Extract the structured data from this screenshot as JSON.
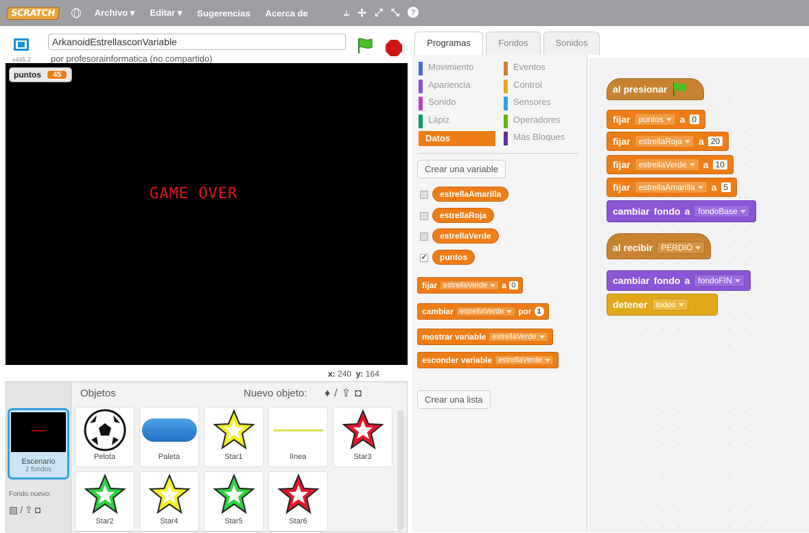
{
  "topbar": {
    "logo": "SCRATCH",
    "menus": [
      "Archivo ▾",
      "Editar ▾",
      "Sugerencias",
      "Acerca de"
    ],
    "tools": [
      "⥿",
      "✢",
      "⤢",
      "⤡",
      "?"
    ],
    "tool_icons": [
      "duplicate-stamp-icon",
      "delete-scissors-icon",
      "grow-icon",
      "shrink-icon",
      "help-icon"
    ]
  },
  "stage": {
    "version": "v445.2",
    "project_title": "ArkanoidEstrellasconVariable",
    "author": "por profesorainformatica (no compartido)",
    "monitor_label": "puntos",
    "monitor_value": "45",
    "game_over_text": "GAME OVER",
    "coords_x_label": "x:",
    "coords_x": "240",
    "coords_y_label": "y:",
    "coords_y": "164"
  },
  "sprites_pane": {
    "header": "Objetos",
    "new_object_label": "Nuevo objeto:",
    "stage_name": "Escenario",
    "stage_backdrops": "2 fondos",
    "new_backdrop_label": "Fondo nuevo:",
    "sprites": [
      "Pelota",
      "Paleta",
      "Star1",
      "línea",
      "Star3",
      "Star2",
      "Star4",
      "Star5",
      "Star6"
    ]
  },
  "tabs": [
    "Programas",
    "Fondos",
    "Sonidos"
  ],
  "categories": [
    {
      "label": "Movimiento",
      "color": "#4a6cd4"
    },
    {
      "label": "Eventos",
      "color": "#c88330"
    },
    {
      "label": "Apariencia",
      "color": "#8a55d7"
    },
    {
      "label": "Control",
      "color": "#e1a91a"
    },
    {
      "label": "Sonido",
      "color": "#bb42c3"
    },
    {
      "label": "Sensores",
      "color": "#2ca5e2"
    },
    {
      "label": "Lápiz",
      "color": "#0e9a6c"
    },
    {
      "label": "Operadores",
      "color": "#5cb712"
    },
    {
      "label": "Datos",
      "color": "#ee7d16"
    },
    {
      "label": "Más Bloques",
      "color": "#632d99"
    }
  ],
  "palette": {
    "make_variable": "Crear una variable",
    "variables": [
      "estrellaAmarilla",
      "estrellaRoja",
      "estrellaVerde",
      "puntos"
    ],
    "checked": "✓",
    "set_block": {
      "kw": "fijar",
      "var": "estrellaVerde",
      "to": "a",
      "val": "0"
    },
    "change_block": {
      "kw": "cambiar",
      "var": "estrellaVerde",
      "by": "por",
      "val": "1"
    },
    "show_block": {
      "kw": "mostrar variable",
      "var": "estrellaVerde"
    },
    "hide_block": {
      "kw": "esconder variable",
      "var": "estrellaVerde"
    },
    "make_list": "Crear una lista"
  },
  "script1": {
    "hat": "al presionar",
    "blocks": [
      {
        "kw": "fijar",
        "var": "puntos",
        "to": "a",
        "val": "0"
      },
      {
        "kw": "fijar",
        "var": "estrellaRoja",
        "to": "a",
        "val": "20"
      },
      {
        "kw": "fijar",
        "var": "estrellaVerde",
        "to": "a",
        "val": "10"
      },
      {
        "kw": "fijar",
        "var": "estrellaAmarilla",
        "to": "a",
        "val": "5"
      }
    ],
    "switch": {
      "kw1": "cambiar",
      "kw2": "fondo",
      "kw3": "a",
      "val": "fondoBase"
    }
  },
  "script2": {
    "hat": "al recibir",
    "msg": "PERDIÓ",
    "switch": {
      "kw1": "cambiar",
      "kw2": "fondo",
      "kw3": "a",
      "val": "fondoFIN"
    },
    "stop": {
      "kw": "detener",
      "val": "todos"
    }
  },
  "colors": {
    "data": "#ee7d16",
    "events": "#c88330",
    "looks": "#8a55d7",
    "control": "#e1a91a",
    "stage_accent": "#30a0e0"
  }
}
